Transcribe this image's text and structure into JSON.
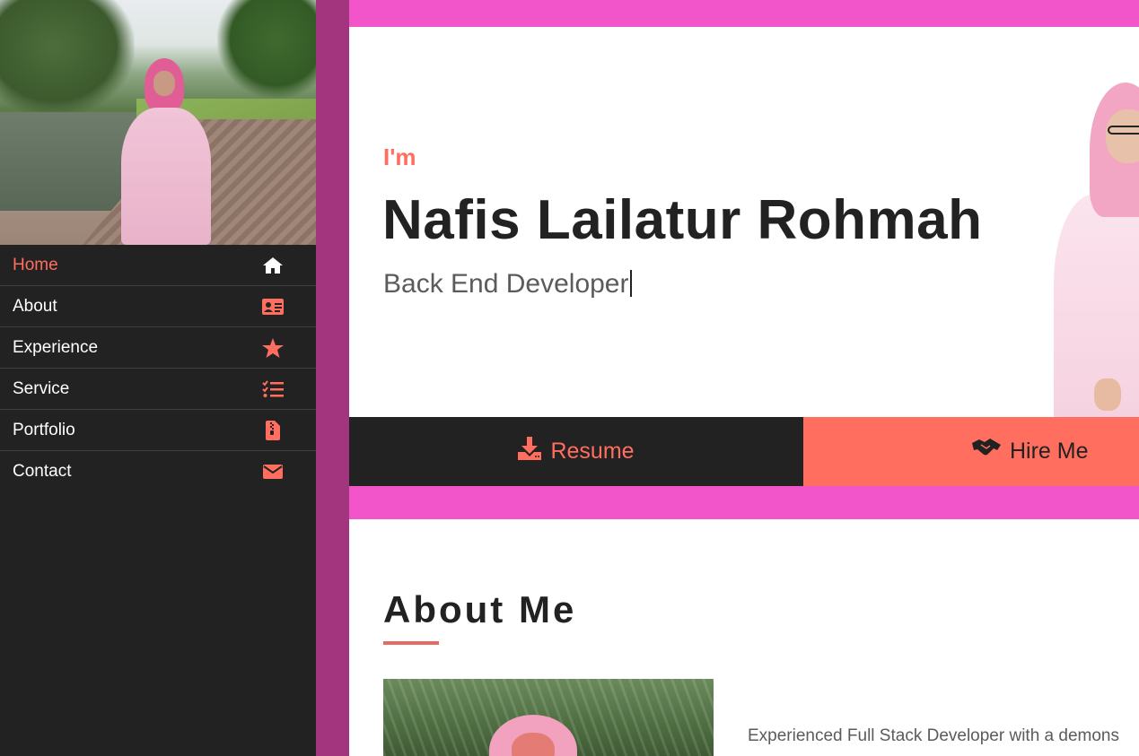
{
  "colors": {
    "accent": "#ff6e5e",
    "pink_band": "#f255c9",
    "purple_gutter": "#a3357f",
    "dark": "#222222"
  },
  "sidebar": {
    "items": [
      {
        "label": "Home",
        "icon": "home-icon",
        "active": true
      },
      {
        "label": "About",
        "icon": "id-card-icon",
        "active": false
      },
      {
        "label": "Experience",
        "icon": "star-icon",
        "active": false
      },
      {
        "label": "Service",
        "icon": "checklist-icon",
        "active": false
      },
      {
        "label": "Portfolio",
        "icon": "file-zip-icon",
        "active": false
      },
      {
        "label": "Contact",
        "icon": "envelope-icon",
        "active": false
      }
    ]
  },
  "hero": {
    "intro": "I'm",
    "name": "Nafis Lailatur Rohmah",
    "role": "Back End Developer"
  },
  "buttons": {
    "resume": {
      "label": "Resume",
      "icon": "download-icon"
    },
    "hire": {
      "label": "Hire Me",
      "icon": "handshake-icon"
    }
  },
  "about": {
    "title": "About Me",
    "text_line1": "Experienced Full Stack Developer with a demons"
  }
}
